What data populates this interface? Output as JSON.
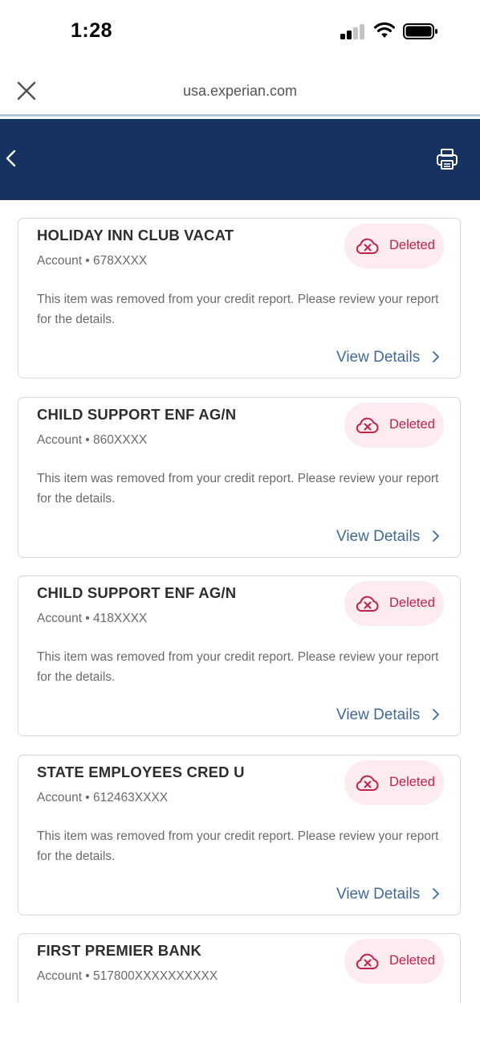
{
  "status_bar": {
    "time": "1:28"
  },
  "browser": {
    "url": "usa.experian.com"
  },
  "colors": {
    "header": "#163261",
    "deleted_accent": "#c1234a",
    "deleted_bg": "#fcecef",
    "link": "#3f6a96"
  },
  "cards": [
    {
      "title": "HOLIDAY INN CLUB VACAT",
      "account": "Account • 678XXXX",
      "status": "Deleted",
      "description": "This item was removed from your credit report. Please review your report for the details.",
      "link": "View Details"
    },
    {
      "title": "CHILD SUPPORT ENF AG/N",
      "account": "Account • 860XXXX",
      "status": "Deleted",
      "description": "This item was removed from your credit report. Please review your report for the details.",
      "link": "View Details"
    },
    {
      "title": "CHILD SUPPORT ENF AG/N",
      "account": "Account • 418XXXX",
      "status": "Deleted",
      "description": "This item was removed from your credit report. Please review your report for the details.",
      "link": "View Details"
    },
    {
      "title": "STATE EMPLOYEES CRED U",
      "account": "Account • 612463XXXX",
      "status": "Deleted",
      "description": "This item was removed from your credit report. Please review your report for the details.",
      "link": "View Details"
    },
    {
      "title": "FIRST PREMIER BANK",
      "account": "Account • 517800XXXXXXXXXX",
      "status": "Deleted"
    }
  ]
}
